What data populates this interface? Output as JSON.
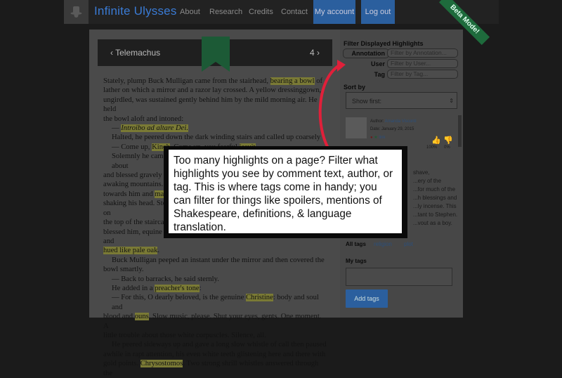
{
  "header": {
    "brand": "Infinite Ulysses",
    "nav": [
      "About",
      "Research",
      "Credits",
      "Contact"
    ],
    "account": "My account",
    "logout": "Log out",
    "beta": "Beta Mode!"
  },
  "chapter": {
    "prev": "‹ Telemachus",
    "next": "4 ›"
  },
  "text_lines": [
    "Stately, plump Buck Mulligan came from the stairhead, bearing a bowl of",
    "lather on which a mirror and a razor lay crossed. A yellow dressinggown,",
    "ungirdled, was sustained gently behind him by the mild morning air. He held",
    "the bowl aloft and intoned:",
    "— Introibo ad altare Dei.",
    "Halted, he peered down the dark winding stairs and called up coarsely :",
    "— Come up, Kinch. Come up, you fearful jesuit.",
    "Solemnly he came forward and mounted the round gunrest. He faced about",
    "and blessed gravely thrice the tower, the surrounding country and the",
    "awaking mountains. Then, catching sight of Stephen Dedalus, he bent",
    "towards him and made rapid crosses in the air, gurgling in his throat and",
    "shaking his head. Stephen Dedalus, displeased and sleepy, leaned his arms on",
    "the top of the staircase and looked coldly at the shaking gurgling face that",
    "blessed him, equine in its length, and at the light untonsured hair, grained and",
    "hued like pale oak.",
    "Buck Mulligan peeped an instant under the mirror and then covered the",
    "bowl smartly.",
    "— Back to barracks, he said sternly.",
    "He added in a preacher's tone:",
    "— For this, O dearly beloved, is the genuine Christine: body and soul and",
    "blood and ouns. Slow music, please. Shut your eyes, gents. One moment. A",
    "little trouble about those white corpuscles. Silence, all.",
    "He peered sideways up and gave a long slow whistle of call then paused",
    "awhile in rapt attention, his even white teeth glistening here and there with",
    "gold points. Chrysostomos. Two strong shrill whistles answered through the"
  ],
  "sidebar": {
    "heading": "Filter Displayed Highlights",
    "filters": [
      {
        "label": "Annotation",
        "placeholder": "Filter by Annotation..."
      },
      {
        "label": "User",
        "placeholder": "Filter by User..."
      },
      {
        "label": "Tag",
        "placeholder": "Filter by Tag..."
      }
    ],
    "sort_label": "Sort by",
    "sort_value": "Show first:",
    "annotation": {
      "author_label": "Author:",
      "author": "Amanda Visconti",
      "date": "Date: January 29, 2015",
      "link": "link",
      "agree_pct": "100%",
      "disagree_pct": "0%",
      "body_lines": [
        "shave,",
        "...ery of the",
        "...for much of the",
        "...h blessings and",
        "...ly incense. This",
        "...tant to Stephen.",
        "...vout as a boy."
      ]
    },
    "all_tags_label": "All tags",
    "tags": [
      "religion",
      "plot"
    ],
    "my_tags_label": "My tags",
    "add_tags": "Add tags"
  },
  "tooltip": {
    "text": "Too many highlights on a page? Filter what highlights you see by comment text, author, or tag. This is where tags come in handy; you can filter for things like spoilers, mentions of Shakespeare, definitions, & language translation."
  },
  "colors": {
    "accent": "#2b5f9e",
    "highlight": "#7a7a35",
    "arrow": "#e0203a",
    "beta": "#1e6b3c"
  }
}
